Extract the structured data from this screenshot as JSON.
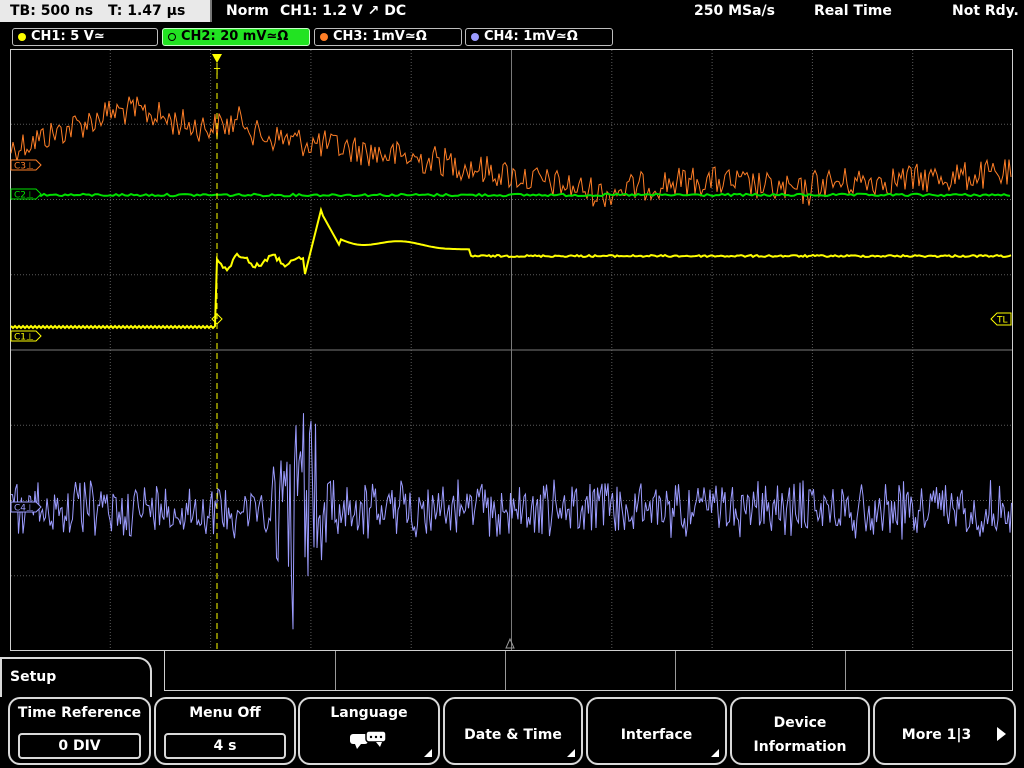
{
  "status_bar": {
    "timebase": "TB: 500 ns",
    "trigger_time": "T: 1.47 µs",
    "mode": "Norm",
    "trigger_info": "CH1: 1.2 V ↗ DC",
    "sample_rate": "250 MSa/s",
    "acq_mode": "Real Time",
    "state": "Not Rdy."
  },
  "channels": [
    {
      "label": "CH1: 5 V≃",
      "color": "#ffff00",
      "active": false
    },
    {
      "label": "CH2: 20 mV≃Ω",
      "color": "#00ff00",
      "active": true
    },
    {
      "label": "CH3: 1mV≃Ω",
      "color": "#ff8000",
      "active": false
    },
    {
      "label": "CH4: 1mV≃Ω",
      "color": "#9999ff",
      "active": false
    }
  ],
  "markers": {
    "c3": "C3⊥",
    "c2": "C2⊥",
    "c1": "C1⊥",
    "c4": "C4⊥",
    "tl": "TL",
    "trigger_t": "T"
  },
  "menu": {
    "title": "Setup",
    "softkeys": [
      {
        "title": "Time Reference",
        "value": "0 DIV"
      },
      {
        "title": "Menu Off",
        "value": "4 s"
      },
      {
        "title": "Language",
        "icon": "speech-bubble-icon"
      },
      {
        "title": "Date & Time"
      },
      {
        "title": "Interface"
      },
      {
        "title": "Device",
        "title2": "Information"
      },
      {
        "title": "More 1|3"
      }
    ]
  },
  "colors": {
    "ch1": "#ffff00",
    "ch2": "#00e000",
    "ch3": "#ff7f27",
    "ch4": "#9c9cff",
    "grid": "#5a5a5a",
    "active_tab": "#22e322"
  }
}
